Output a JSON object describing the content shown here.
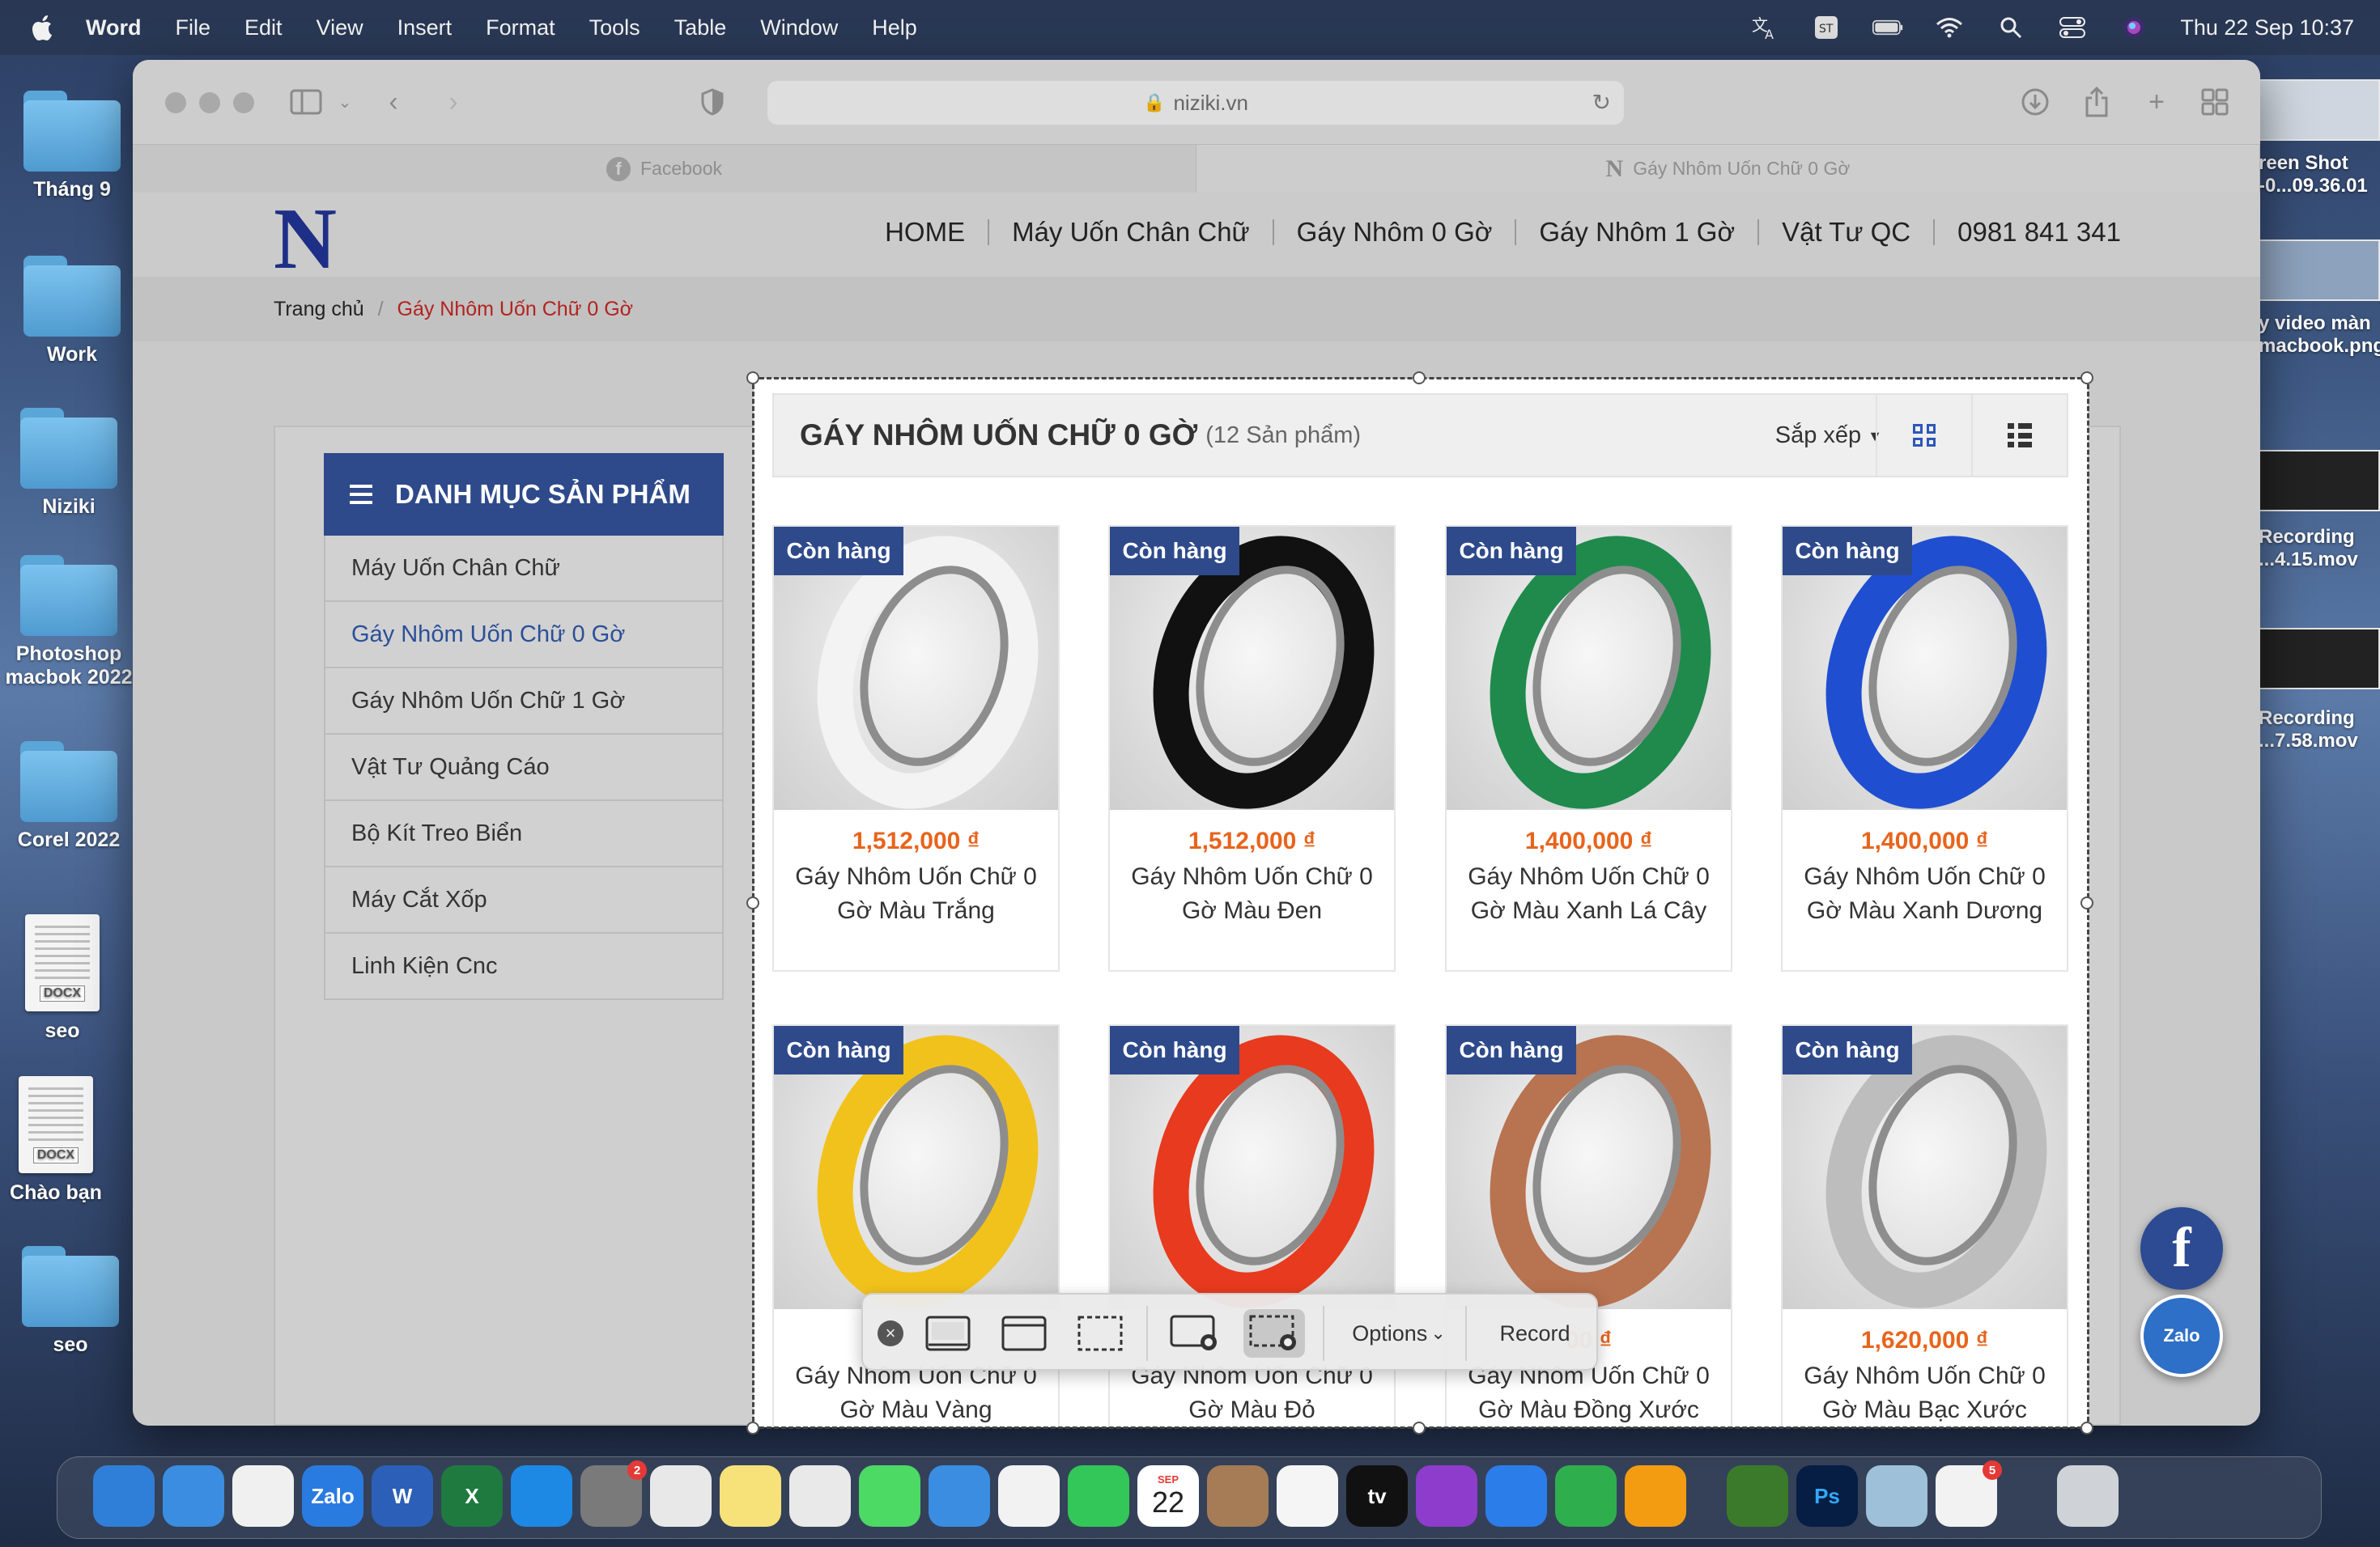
{
  "menubar": {
    "app": "Word",
    "items": [
      "File",
      "Edit",
      "View",
      "Insert",
      "Format",
      "Tools",
      "Table",
      "Window",
      "Help"
    ],
    "clock": "Thu 22 Sep  10:37"
  },
  "desktop_left": [
    {
      "label": "Tháng 9",
      "kind": "folder"
    },
    {
      "label": "Work",
      "kind": "folder"
    },
    {
      "label": "Niziki",
      "kind": "folder"
    },
    {
      "label": "Photoshop macbok 2022",
      "kind": "folder"
    },
    {
      "label": "Corel 2022",
      "kind": "folder"
    },
    {
      "label": "seo",
      "kind": "docx",
      "tag": "DOCX"
    },
    {
      "label": "Chào bạn",
      "kind": "docx",
      "tag": "DOCX"
    },
    {
      "label": "seo",
      "kind": "folder"
    }
  ],
  "desktop_right": [
    {
      "label": "reen Shot\n-0...09.36.01"
    },
    {
      "label": "y video màn\nmacbook.png"
    },
    {
      "label": "Recording\n...4.15.mov"
    },
    {
      "label": "Recording\n...7.58.mov"
    }
  ],
  "browser": {
    "url": "niziki.vn",
    "tabs": [
      {
        "label": "Facebook",
        "favicon": "facebook-icon"
      },
      {
        "label": "Gáy Nhôm Uốn Chữ 0 Gờ",
        "favicon": "N"
      }
    ]
  },
  "site": {
    "logo": "N",
    "nav": [
      "HOME",
      "Máy Uốn Chân Chữ",
      "Gáy Nhôm 0 Gờ",
      "Gáy Nhôm 1 Gờ",
      "Vật Tư QC",
      "0981 841 341"
    ],
    "breadcrumb": {
      "home": "Trang chủ",
      "separator": "/",
      "current": "Gáy Nhôm Uốn Chữ 0 Gờ"
    },
    "sidebar": {
      "title": "DANH MỤC SẢN PHẨM",
      "items": [
        "Máy Uốn Chân Chữ",
        "Gáy Nhôm Uốn Chữ 0 Gờ",
        "Gáy Nhôm Uốn Chữ 1 Gờ",
        "Vật Tư Quảng Cáo",
        "Bộ Kít Treo Biển",
        "Máy Cắt Xốp",
        "Linh Kiện Cnc"
      ],
      "active_index": 1
    },
    "category": {
      "title": "GÁY NHÔM UỐN CHỮ 0 GỜ",
      "count": "(12 Sản phẩm)",
      "sort_label": "Sắp xếp"
    },
    "products": [
      {
        "badge": "Còn hàng",
        "price": "1,512,000 ₫",
        "name": "Gáy Nhôm Uốn Chữ 0 Gờ Màu Trắng",
        "color": "#f3f3f3"
      },
      {
        "badge": "Còn hàng",
        "price": "1,512,000 ₫",
        "name": "Gáy Nhôm Uốn Chữ 0 Gờ Màu Đen",
        "color": "#111111"
      },
      {
        "badge": "Còn hàng",
        "price": "1,400,000 ₫",
        "name": "Gáy Nhôm Uốn Chữ 0 Gờ Màu Xanh Lá Cây",
        "color": "#1f8a4c"
      },
      {
        "badge": "Còn hàng",
        "price": "1,400,000 ₫",
        "name": "Gáy Nhôm Uốn Chữ 0 Gờ Màu Xanh Dương",
        "color": "#1f4fd0"
      },
      {
        "badge": "Còn hàng",
        "price": "",
        "name": "Gáy Nhôm Uốn Chữ 0 Gờ Màu Vàng",
        "color": "#f2c21c"
      },
      {
        "badge": "Còn hàng",
        "price": "",
        "name": "Gáy Nhôm Uốn Chữ 0 Gờ Màu Đỏ",
        "color": "#e83a1e"
      },
      {
        "badge": "Còn hàng",
        "price": "00 ₫",
        "name": "Gáy Nhôm Uốn Chữ 0 Gờ Màu Đồng Xước",
        "color": "#b87350"
      },
      {
        "badge": "Còn hàng",
        "price": "1,620,000 ₫",
        "name": "Gáy Nhôm Uốn Chữ 0 Gờ Màu Bạc Xước",
        "color": "#bdbdbd"
      }
    ]
  },
  "capture_toolbar": {
    "options_label": "Options",
    "record_label": "Record"
  },
  "dock": {
    "apps": [
      "Finder",
      "Safari",
      "Chrome",
      "Zalo",
      "W",
      "X",
      "App Store",
      "System Preferences",
      "Maps",
      "Notes",
      "Launchpad",
      "Messages",
      "Mail",
      "Photos",
      "FaceTime",
      "22",
      "Contacts",
      "Reminders",
      "tv",
      "Podcasts",
      "Keynote",
      "Numbers",
      "Pages",
      "Pen",
      "Ps",
      "QuickTime",
      "Office",
      "Trash"
    ],
    "calendar_month": "SEP",
    "calendar_day": "22",
    "badges": {
      "system_prefs": "2",
      "office": "5"
    }
  }
}
